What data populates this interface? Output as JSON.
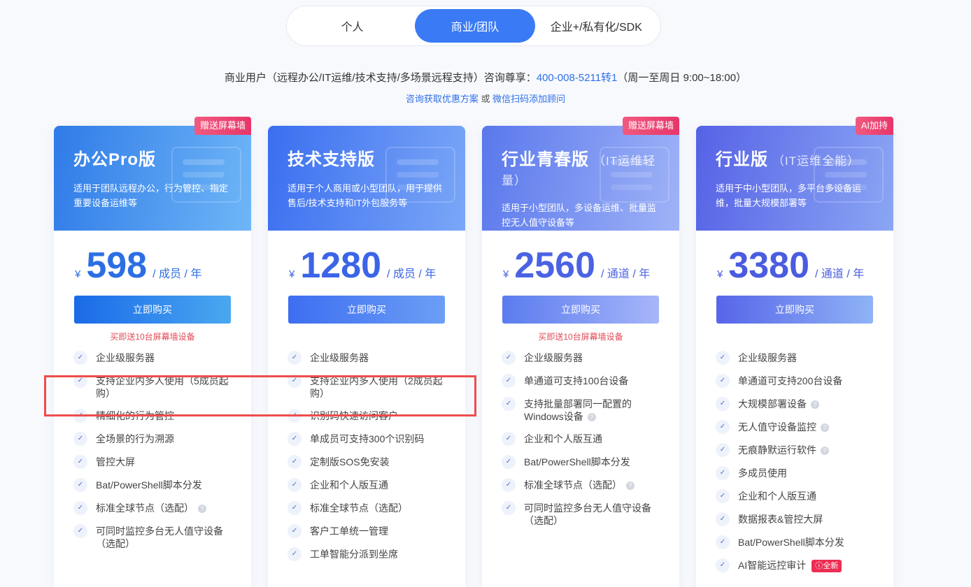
{
  "tabs": [
    {
      "label": "个人",
      "active": false
    },
    {
      "label": "商业/团队",
      "active": true
    },
    {
      "label": "企业+/私有化/SDK",
      "active": false
    }
  ],
  "consult": {
    "prefix": "商业用户（远程办公/IT运维/技术支持/多场景远程支持）咨询尊享：",
    "phone": "400-008-5211转1",
    "hours": "（周一至周日 9:00~18:00）",
    "link1": "咨询获取优惠方案",
    "or": "或",
    "link2": "微信扫码添加顾问"
  },
  "icons": {
    "check": "check-icon",
    "help": "question-icon",
    "info": "info-icon"
  },
  "colors": {
    "primary": "#3a7bf5",
    "badge": "#e8356a",
    "highlight": "#ee4d4d",
    "promo": "#e04a55"
  },
  "plans": [
    {
      "title": "办公Pro版",
      "subtitle": "",
      "desc": "适用于团队远程办公，行为管控、指定重要设备运维等",
      "badge": "赠送屏幕墙",
      "currency": "¥",
      "price": "598",
      "unit": "/ 成员 / 年",
      "button": "立即购买",
      "promo": "买即送10台屏幕墙设备",
      "features": [
        {
          "text": "企业级服务器"
        },
        {
          "text": "支持企业内多人使用（5成员起购）"
        },
        {
          "text": "精细化的行为管控"
        },
        {
          "text": "全场景的行为溯源"
        },
        {
          "text": "管控大屏"
        },
        {
          "text": "Bat/PowerShell脚本分发"
        },
        {
          "text": "标准全球节点（选配）",
          "help": true
        },
        {
          "text": "可同时监控多台无人值守设备（选配）"
        }
      ]
    },
    {
      "title": "技术支持版",
      "subtitle": "",
      "desc": "适用于个人商用或小型团队，用于提供售后/技术支持和IT外包服务等",
      "badge": "",
      "currency": "¥",
      "price": "1280",
      "unit": "/ 成员 / 年",
      "button": "立即购买",
      "promo": "",
      "features": [
        {
          "text": "企业级服务器"
        },
        {
          "text": "支持企业内多人使用（2成员起购）"
        },
        {
          "text": "识别码快速访问客户"
        },
        {
          "text": "单成员可支持300个识别码"
        },
        {
          "text": "定制版SOS免安装"
        },
        {
          "text": "企业和个人版互通"
        },
        {
          "text": "标准全球节点（选配）"
        },
        {
          "text": "客户工单统一管理"
        },
        {
          "text": "工单智能分派到坐席"
        }
      ]
    },
    {
      "title": "行业青春版",
      "subtitle": "（IT运维轻量）",
      "desc": "适用于小型团队，多设备运维、批量监控无人值守设备等",
      "badge": "赠送屏幕墙",
      "currency": "¥",
      "price": "2560",
      "unit": "/ 通道 / 年",
      "button": "立即购买",
      "promo": "买即送10台屏幕墙设备",
      "features": [
        {
          "text": "企业级服务器"
        },
        {
          "text": "单通道可支持100台设备"
        },
        {
          "text": "支持批量部署同一配置的Windows设备",
          "help": true
        },
        {
          "text": "企业和个人版互通"
        },
        {
          "text": "Bat/PowerShell脚本分发"
        },
        {
          "text": "标准全球节点（选配）",
          "help": true
        },
        {
          "text": "可同时监控多台无人值守设备（选配）"
        }
      ]
    },
    {
      "title": "行业版",
      "subtitle": "（IT运维全能）",
      "desc": "适用于中小型团队，多平台多设备运维，批量大规模部署等",
      "badge": "AI加持",
      "currency": "¥",
      "price": "3380",
      "unit": "/ 通道 / 年",
      "button": "立即购买",
      "promo": "",
      "features": [
        {
          "text": "企业级服务器"
        },
        {
          "text": "单通道可支持200台设备"
        },
        {
          "text": "大规模部署设备",
          "help": true
        },
        {
          "text": "无人值守设备监控",
          "help": true
        },
        {
          "text": "无痕静默运行软件",
          "help": true
        },
        {
          "text": "多成员使用"
        },
        {
          "text": "企业和个人版互通"
        },
        {
          "text": "数据报表&管控大屏"
        },
        {
          "text": "Bat/PowerShell脚本分发"
        },
        {
          "text": "AI智能远控审计",
          "tag": "ⓘ全新"
        }
      ]
    }
  ]
}
